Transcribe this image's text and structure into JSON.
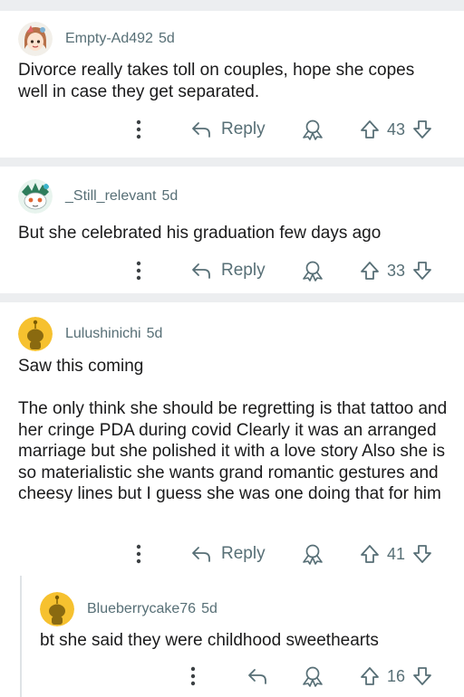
{
  "comments": [
    {
      "author": "Empty-Ad492",
      "age": "5d",
      "text": "Divorce really takes toll on couples, hope she copes well in case they get separated.",
      "reply_label": "Reply",
      "score": "43"
    },
    {
      "author": "_Still_relevant",
      "age": "5d",
      "text": "But she celebrated his graduation few days ago",
      "reply_label": "Reply",
      "score": "33"
    },
    {
      "author": "Lulushinichi",
      "age": "5d",
      "text": "Saw this coming\n\nThe only think she should be regretting is that tattoo and her cringe PDA during covid Clearly it was an arranged marriage but she polished it with a love story Also she is so materialistic she wants grand romantic gestures and cheesy lines but I guess she was one doing that for him",
      "reply_label": "Reply",
      "score": "41"
    },
    {
      "author": "Blueberrycake76",
      "age": "5d",
      "text": "bt she said they were childhood sweethearts",
      "score": "16"
    }
  ],
  "colors": {
    "background": "#ffffff",
    "page_gap": "#eceef0",
    "meta_text": "#576f76",
    "body_text": "#1a1a1b",
    "avatar_yellow": "#f6c12f"
  },
  "icons": [
    "more-icon",
    "reply-arrow-icon",
    "award-icon",
    "upvote-icon",
    "downvote-icon"
  ]
}
